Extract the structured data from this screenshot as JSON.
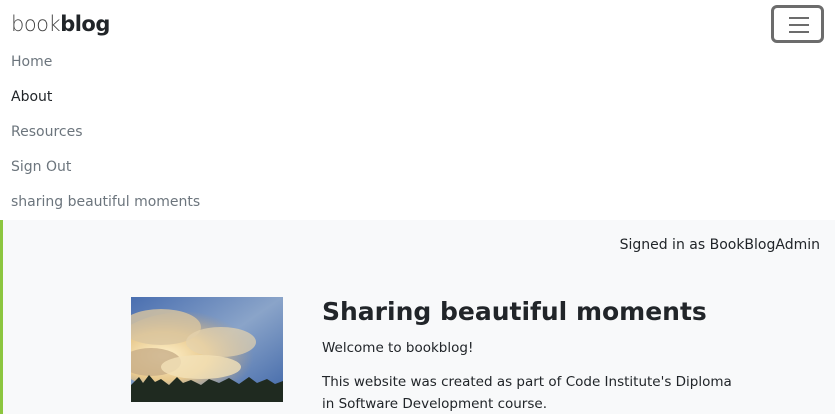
{
  "brand": {
    "light": "book",
    "bold": "blog"
  },
  "nav": {
    "toggler_icon": "hamburger-menu-icon",
    "items": [
      {
        "label": "Home"
      },
      {
        "label": "About"
      },
      {
        "label": "Resources"
      },
      {
        "label": "Sign Out"
      },
      {
        "label": "sharing beautiful moments"
      }
    ]
  },
  "status": {
    "signed_in": "Signed in as BookBlogAdmin"
  },
  "hero": {
    "title": "Sharing beautiful moments",
    "welcome": "Welcome to bookblog!",
    "description": "This website was created as part of Code Institute's Diploma in Software Development course."
  },
  "colors": {
    "accent": "#8cc63f",
    "nav_link": "#6c757d",
    "nav_active": "#212529",
    "band_bg": "#f8f9fa"
  }
}
